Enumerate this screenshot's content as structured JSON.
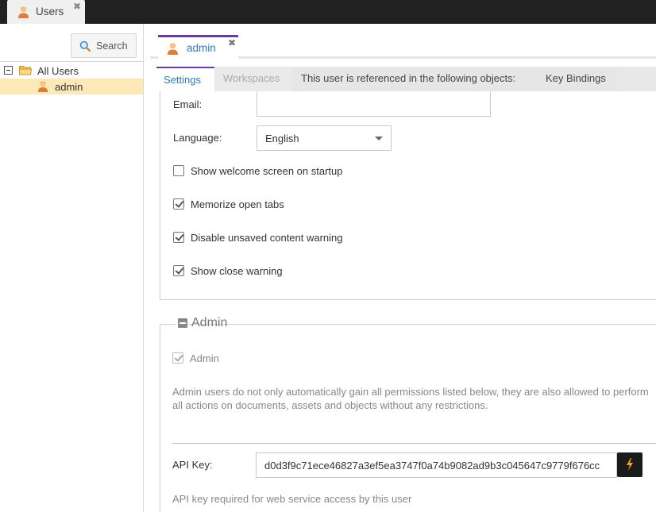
{
  "top_tabs": [
    {
      "label": "Users",
      "icon": "user-icon"
    }
  ],
  "sidebar": {
    "search_label": "Search",
    "tree": [
      {
        "label": "All Users",
        "icon": "folder-icon",
        "expanded": true
      },
      {
        "label": "admin",
        "icon": "user-icon",
        "selected": true
      }
    ]
  },
  "editor": {
    "tab_label": "admin",
    "subtabs": [
      {
        "label": "Settings",
        "state": "active"
      },
      {
        "label": "Workspaces",
        "state": "disabled"
      },
      {
        "label": "This user is referenced in the following objects:",
        "state": "normal"
      },
      {
        "label": "Key Bindings",
        "state": "normal"
      }
    ]
  },
  "settings": {
    "email_label": "Email:",
    "email_value": "",
    "language_label": "Language:",
    "language_value": "English",
    "checkboxes": [
      {
        "label": "Show welcome screen on startup",
        "checked": false
      },
      {
        "label": "Memorize open tabs",
        "checked": true
      },
      {
        "label": "Disable unsaved content warning",
        "checked": true
      },
      {
        "label": "Show close warning",
        "checked": true
      }
    ]
  },
  "admin": {
    "legend": "Admin",
    "admin_checkbox_label": "Admin",
    "admin_checked": true,
    "description": "Admin users do not only automatically gain all permissions listed below, they are also allowed to perform all actions on documents, assets and objects without any restrictions.",
    "api_key_label": "API Key:",
    "api_key_value": "d0d3f9c71ece46827a3ef5ea3747f0a74b9082ad9b3c045647c9779f676cc",
    "api_key_help": "API key required for web service access by this user"
  },
  "colors": {
    "topbar": "#212121",
    "accent_purple": "#6a3b9c",
    "link_blue": "#2e7bb5",
    "selected_row": "#fde8b8"
  }
}
